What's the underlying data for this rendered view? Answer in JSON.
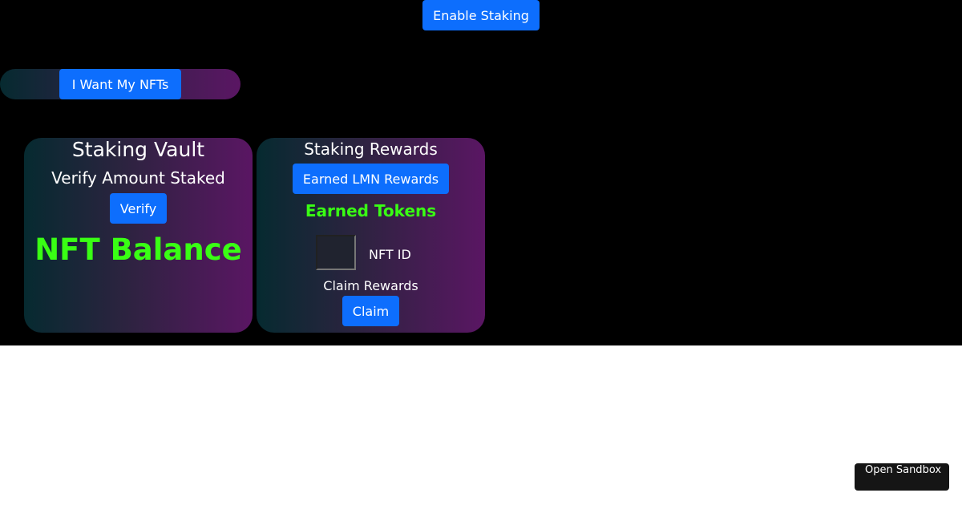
{
  "header": {
    "enable_staking_label": "Enable Staking"
  },
  "nft_bar": {
    "want_nfts_label": "I Want My NFTs"
  },
  "vault": {
    "title": "Staking Vault",
    "subtitle": "Verify Amount Staked",
    "verify_label": "Verify",
    "balance_label": "NFT Balance"
  },
  "rewards": {
    "title": "Staking Rewards",
    "earned_button_label": "Earned LMN Rewards",
    "earned_tokens_label": "Earned Tokens",
    "nft_id_value": "",
    "nft_id_label": "NFT ID",
    "claim_rewards_label": "Claim Rewards",
    "claim_label": "Claim"
  },
  "footer": {
    "open_sandbox_label": "Open Sandbox"
  },
  "colors": {
    "button_blue": "#0d6efd",
    "highlight_green": "#39ff14",
    "background": "#000000"
  }
}
